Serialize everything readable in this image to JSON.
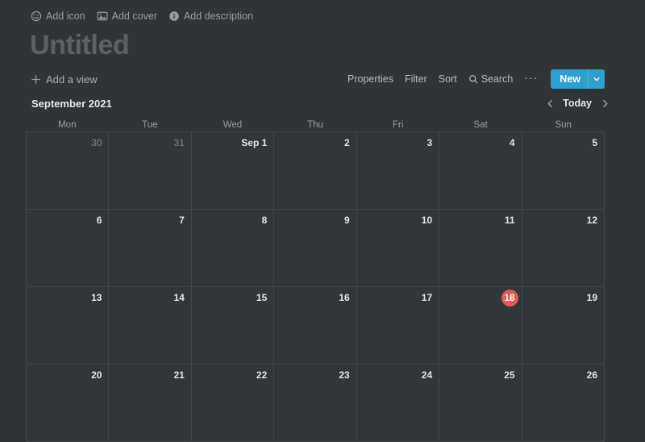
{
  "page_actions": [
    {
      "label": "Add icon",
      "icon": "smiley-icon"
    },
    {
      "label": "Add cover",
      "icon": "image-icon"
    },
    {
      "label": "Add description",
      "icon": "info-icon"
    }
  ],
  "title": "Untitled",
  "view_bar": {
    "add_view_label": "Add a view",
    "add_view_icon": "plus-icon",
    "tools": [
      {
        "label": "Properties"
      },
      {
        "label": "Filter"
      },
      {
        "label": "Sort"
      },
      {
        "label": "Search",
        "icon": "search-icon"
      }
    ],
    "overflow_label": "···",
    "new_button": {
      "label": "New",
      "caret_icon": "chevron-down-icon",
      "color": "#2f9fd0"
    }
  },
  "calendar": {
    "month_label": "September 2021",
    "nav": {
      "prev_icon": "chevron-left-icon",
      "today_label": "Today",
      "next_icon": "chevron-right-icon"
    },
    "weekdays": [
      "Mon",
      "Tue",
      "Wed",
      "Thu",
      "Fri",
      "Sat",
      "Sun"
    ],
    "today_color": "#e05a52",
    "days": [
      {
        "label": "30",
        "state": "other-month"
      },
      {
        "label": "31",
        "state": "other-month"
      },
      {
        "label": "Sep 1",
        "state": "current-month"
      },
      {
        "label": "2",
        "state": "current-month"
      },
      {
        "label": "3",
        "state": "current-month"
      },
      {
        "label": "4",
        "state": "current-month"
      },
      {
        "label": "5",
        "state": "current-month"
      },
      {
        "label": "6",
        "state": "current-month"
      },
      {
        "label": "7",
        "state": "current-month"
      },
      {
        "label": "8",
        "state": "current-month"
      },
      {
        "label": "9",
        "state": "current-month"
      },
      {
        "label": "10",
        "state": "current-month"
      },
      {
        "label": "11",
        "state": "current-month"
      },
      {
        "label": "12",
        "state": "current-month"
      },
      {
        "label": "13",
        "state": "current-month"
      },
      {
        "label": "14",
        "state": "current-month"
      },
      {
        "label": "15",
        "state": "current-month"
      },
      {
        "label": "16",
        "state": "current-month"
      },
      {
        "label": "17",
        "state": "current-month"
      },
      {
        "label": "18",
        "state": "today"
      },
      {
        "label": "19",
        "state": "current-month"
      },
      {
        "label": "20",
        "state": "current-month"
      },
      {
        "label": "21",
        "state": "current-month"
      },
      {
        "label": "22",
        "state": "current-month"
      },
      {
        "label": "23",
        "state": "current-month"
      },
      {
        "label": "24",
        "state": "current-month"
      },
      {
        "label": "25",
        "state": "current-month"
      },
      {
        "label": "26",
        "state": "current-month"
      }
    ]
  }
}
